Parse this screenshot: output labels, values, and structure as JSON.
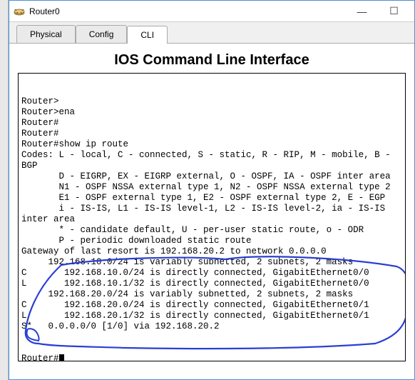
{
  "window": {
    "title": "Router0",
    "min_label": "—",
    "max_label": "☐"
  },
  "tabs": {
    "physical": "Physical",
    "config": "Config",
    "cli": "CLI"
  },
  "cli": {
    "heading": "IOS Command Line Interface"
  },
  "terminal": {
    "lines": [
      "Router>",
      "Router>ena",
      "Router#",
      "Router#",
      "Router#show ip route",
      "Codes: L - local, C - connected, S - static, R - RIP, M - mobile, B -",
      "BGP",
      "       D - EIGRP, EX - EIGRP external, O - OSPF, IA - OSPF inter area",
      "       N1 - OSPF NSSA external type 1, N2 - OSPF NSSA external type 2",
      "       E1 - OSPF external type 1, E2 - OSPF external type 2, E - EGP",
      "       i - IS-IS, L1 - IS-IS level-1, L2 - IS-IS level-2, ia - IS-IS",
      "inter area",
      "       * - candidate default, U - per-user static route, o - ODR",
      "       P - periodic downloaded static route",
      "",
      "Gateway of last resort is 192.168.20.2 to network 0.0.0.0",
      "",
      "     192.168.10.0/24 is variably subnetted, 2 subnets, 2 masks",
      "C       192.168.10.0/24 is directly connected, GigabitEthernet0/0",
      "L       192.168.10.1/32 is directly connected, GigabitEthernet0/0",
      "     192.168.20.0/24 is variably subnetted, 2 subnets, 2 masks",
      "C       192.168.20.0/24 is directly connected, GigabitEthernet0/1",
      "L       192.168.20.1/32 is directly connected, GigabitEthernet0/1",
      "S*   0.0.0.0/0 [1/0] via 192.168.20.2"
    ],
    "prompt": "Router#"
  }
}
